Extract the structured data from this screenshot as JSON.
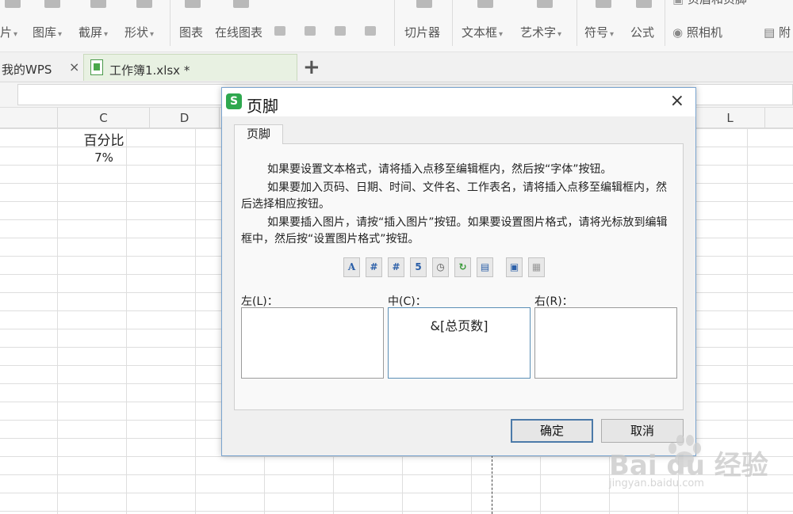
{
  "ribbon": {
    "items": [
      {
        "label": "片",
        "caret": true
      },
      {
        "label": "图库",
        "caret": true
      },
      {
        "label": "截屏",
        "caret": true
      },
      {
        "label": "形状",
        "caret": true
      },
      {
        "label": "图表",
        "caret": false
      },
      {
        "label": "在线图表",
        "caret": false
      },
      {
        "label": "切片器",
        "caret": false
      },
      {
        "label": "文本框",
        "caret": true
      },
      {
        "label": "艺术字",
        "caret": true
      },
      {
        "label": "符号",
        "caret": true
      },
      {
        "label": "公式",
        "caret": false
      },
      {
        "label": "照相机",
        "caret": false
      },
      {
        "label": "附",
        "caret": false
      }
    ],
    "header_footer_label": "页眉和页脚"
  },
  "tabs": {
    "wps_home": "我的WPS",
    "workbook": "工作簿1.xlsx *",
    "close_glyph": "×",
    "new_tab_glyph": "+"
  },
  "sheet": {
    "columns": [
      "C",
      "D",
      "L"
    ],
    "cells": {
      "c1": "百分比",
      "c2": "7%"
    }
  },
  "dialog": {
    "title": "页脚",
    "tab_label": "页脚",
    "instructions": [
      "如果要设置文本格式，请将插入点移至编辑框内，然后按“字体”按钮。",
      "如果要加入页码、日期、时间、文件名、工作表名，请将插入点移至编辑框内，然后选择相应按钮。",
      "如果要插入图片，请按“插入图片”按钮。如果要设置图片格式，请将光标放到编辑框中，然后按“设置图片格式”按钮。"
    ],
    "toolbar_buttons": [
      {
        "icon": "font-icon",
        "glyph": "A"
      },
      {
        "icon": "page-number-icon",
        "glyph": "#"
      },
      {
        "icon": "total-pages-icon",
        "glyph": "#"
      },
      {
        "icon": "date-icon",
        "glyph": "5"
      },
      {
        "icon": "time-icon",
        "glyph": "◷"
      },
      {
        "icon": "file-path-icon",
        "glyph": "↻"
      },
      {
        "icon": "sheet-name-icon",
        "glyph": "▤"
      },
      {
        "icon": "insert-picture-icon",
        "glyph": "▣"
      },
      {
        "icon": "format-picture-icon",
        "glyph": "▦"
      }
    ],
    "sections": {
      "left_label": "左(L)：",
      "center_label": "中(C)：",
      "right_label": "右(R)：",
      "left_value": "",
      "center_value": "&[总页数]",
      "right_value": ""
    },
    "ok_label": "确定",
    "cancel_label": "取消",
    "close_glyph": "×",
    "logo_glyph": "S"
  },
  "watermark": {
    "brand": "Bai du 经验",
    "url": "jingyan.baidu.com"
  }
}
